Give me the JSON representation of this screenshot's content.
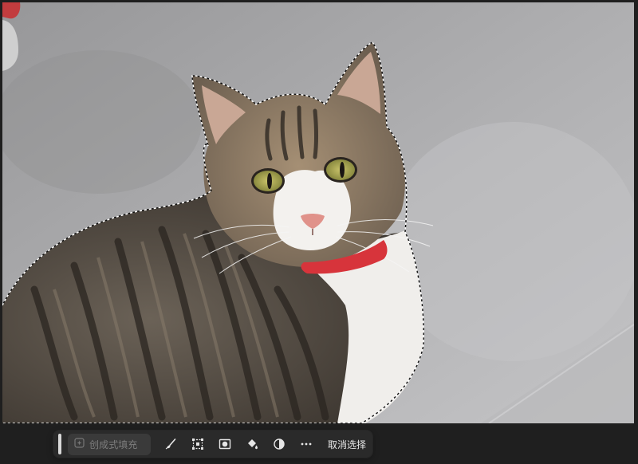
{
  "toolbar": {
    "generative_fill_label": "创成式填充",
    "deselect_label": "取消选择",
    "more_label": "···"
  },
  "icons": {
    "generative_fill": "sparkle-icon",
    "brush": "brush-icon",
    "transform": "selection-transform-icon",
    "mask": "mask-icon",
    "fill": "paint-bucket-icon",
    "adjust": "half-circle-adjust-icon",
    "more": "more-options-icon"
  },
  "colors": {
    "app_background": "#1f1f1f",
    "toolbar_background": "#2a2a2a",
    "field_background": "#3a3a3a",
    "toolbar_text": "#e7e7e7",
    "placeholder_text": "#7d7d7d",
    "collar": "#d7343b"
  }
}
